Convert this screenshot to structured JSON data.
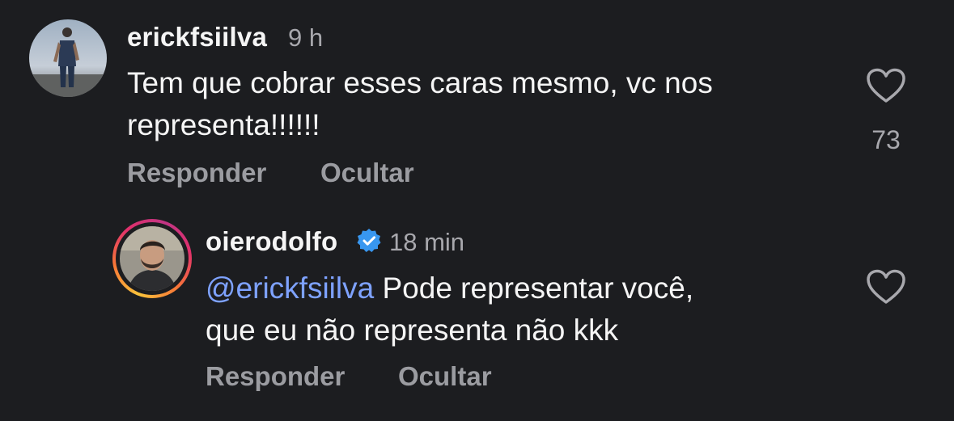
{
  "comments": [
    {
      "username": "erickfsiilva",
      "time": "9 h",
      "text_line1": "Tem que cobrar esses caras mesmo, vc nos",
      "text_line2": "representa!!!!!!",
      "likes": "73",
      "reply_label": "Responder",
      "hide_label": "Ocultar"
    },
    {
      "username": "oierodolfo",
      "verified": true,
      "time": "18 min",
      "mention": "@erickfsiilva",
      "text_line1": " Pode representar você,",
      "text_line2": "que eu não representa não kkk",
      "reply_label": "Responder",
      "hide_label": "Ocultar"
    }
  ],
  "colors": {
    "background": "#1c1d20",
    "mention": "#7ea2ff",
    "verified_badge": "#3897f0",
    "muted_text": "#9b9ca1"
  }
}
